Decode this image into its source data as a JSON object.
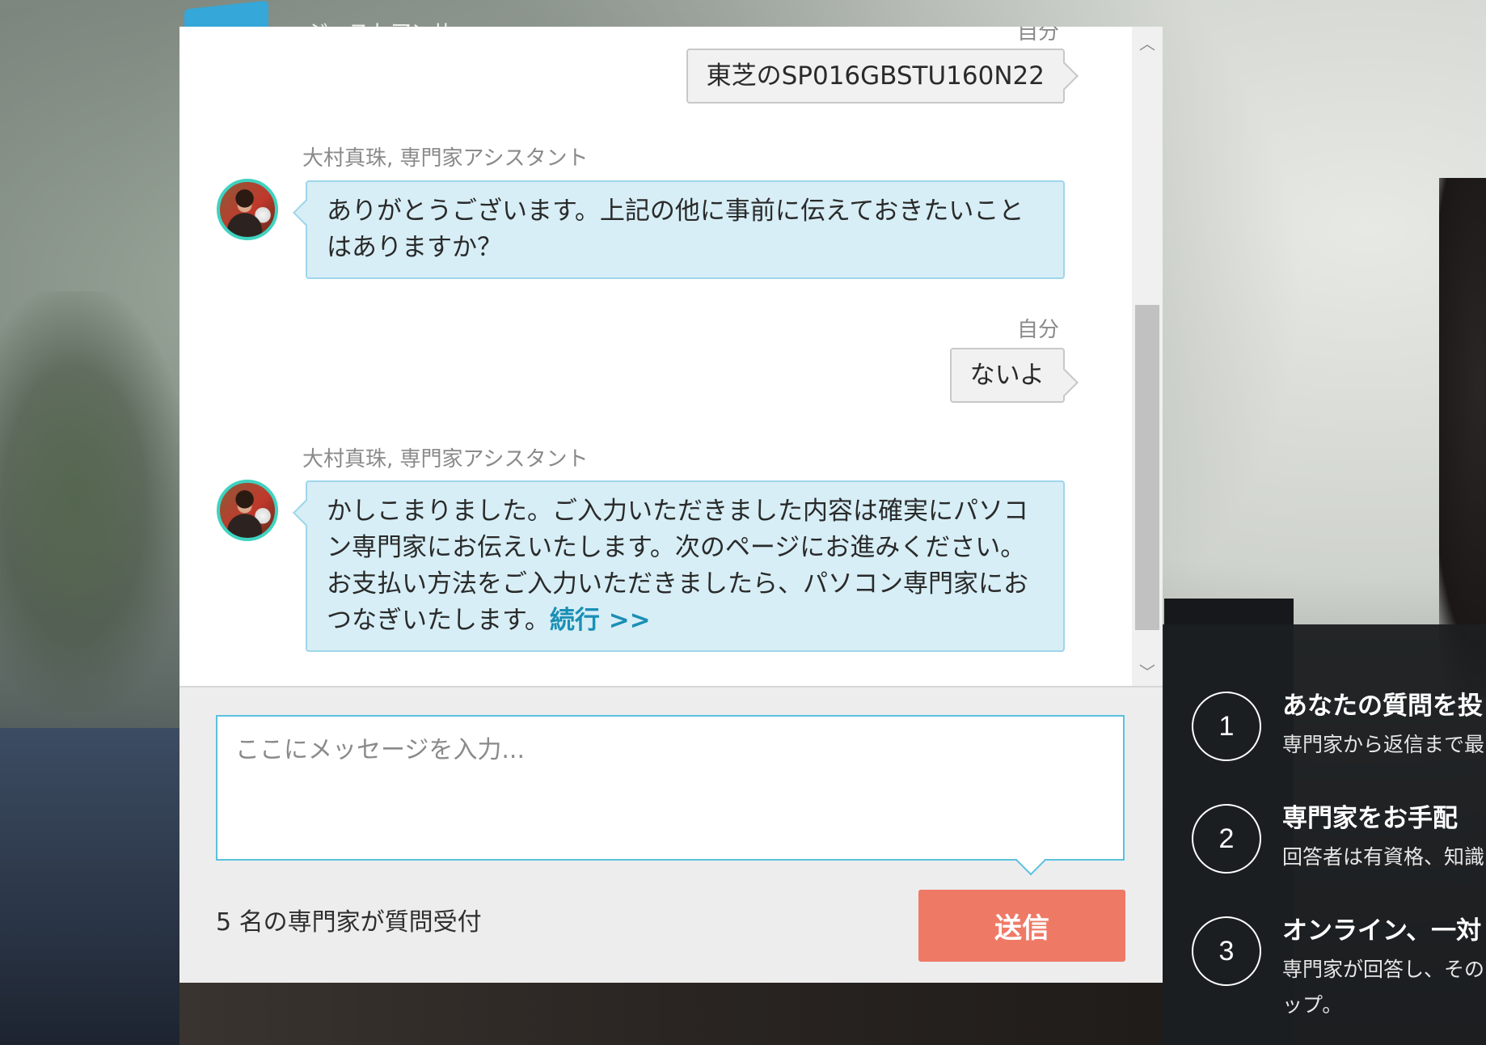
{
  "background": {
    "logo_text": "ジャストアンサー"
  },
  "chat": {
    "messages": [
      {
        "sender": "自分",
        "text": "東芝のSP016GBSTU160N22"
      },
      {
        "sender": "大村真珠, 専門家アシスタント",
        "text": "ありがとうございます。上記の他に事前に伝えておきたいことはありますか？"
      },
      {
        "sender": "自分",
        "text": "ないよ"
      },
      {
        "sender": "大村真珠, 専門家アシスタント",
        "text": "かしこまりました。ご入力いただきました内容は確実にパソコン専門家にお伝えいたします。次のページにお進みください。お支払い方法をご入力いただきましたら、パソコン専門家におつなぎいたします。",
        "link": "続行 >>"
      }
    ],
    "scroll_up_icon": "chevron-up-icon",
    "scroll_down_icon": "chevron-down-icon"
  },
  "composer": {
    "placeholder": "ここにメッセージを入力...",
    "expert_count": "5 名の専門家が質問受付",
    "send_label": "送信",
    "send_color": "#ee7a66",
    "input_border_color": "#5bc0de"
  },
  "steps": [
    {
      "number": "1",
      "title": "あなたの質問を投",
      "desc": "専門家から返信まで最"
    },
    {
      "number": "2",
      "title": "専門家をお手配",
      "desc": "回答者は有資格、知識"
    },
    {
      "number": "3",
      "title": "オンライン、一対",
      "desc": "専門家が回答し、その",
      "desc2": "ップ。"
    }
  ],
  "colors": {
    "agent_bubble": "#d7eef6",
    "agent_bubble_border": "#9fd6ea",
    "avatar_ring": "#3fd3c0",
    "link": "#1a8fb5"
  }
}
